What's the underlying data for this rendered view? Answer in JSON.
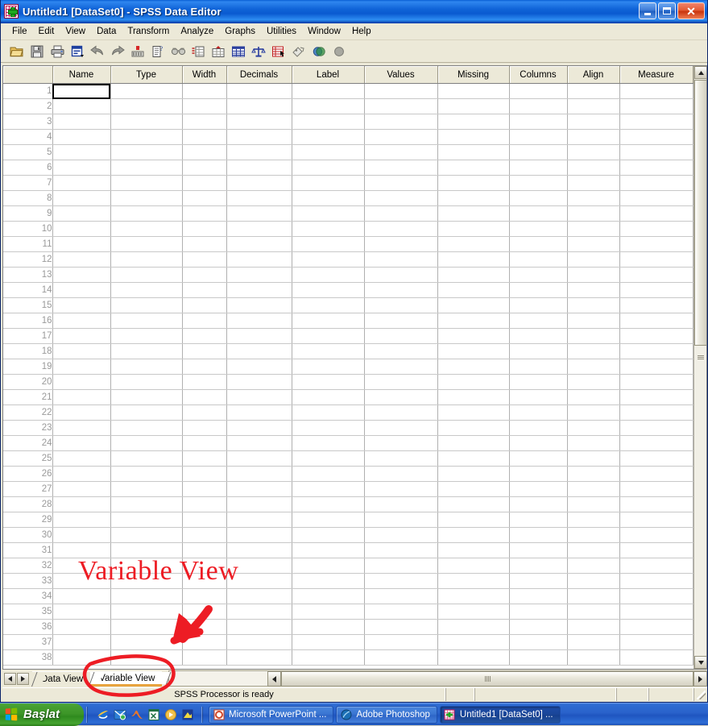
{
  "window": {
    "title": "Untitled1 [DataSet0] - SPSS Data Editor",
    "icon": "spss-icon",
    "minimize_label": "Minimize",
    "restore_label": "Restore",
    "close_label": "Close"
  },
  "menubar": {
    "items": [
      {
        "label": "File"
      },
      {
        "label": "Edit"
      },
      {
        "label": "View"
      },
      {
        "label": "Data"
      },
      {
        "label": "Transform"
      },
      {
        "label": "Analyze"
      },
      {
        "label": "Graphs"
      },
      {
        "label": "Utilities"
      },
      {
        "label": "Window"
      },
      {
        "label": "Help"
      }
    ]
  },
  "toolbar": {
    "buttons": [
      {
        "name": "open-file-icon",
        "title": "Open data document"
      },
      {
        "name": "save-icon",
        "title": "Save this document"
      },
      {
        "name": "print-icon",
        "title": "Print"
      },
      {
        "name": "dialog-recall-icon",
        "title": "Recall recently used dialogs"
      },
      {
        "name": "undo-icon",
        "title": "Undo a user action"
      },
      {
        "name": "redo-icon",
        "title": "Redo a user action"
      },
      {
        "name": "goto-case-icon",
        "title": "Go to case"
      },
      {
        "name": "variables-icon",
        "title": "Variables"
      },
      {
        "name": "find-icon",
        "title": "Find"
      },
      {
        "name": "insert-case-icon",
        "title": "Insert cases"
      },
      {
        "name": "insert-variable-icon",
        "title": "Insert variables"
      },
      {
        "name": "split-file-icon",
        "title": "Split file"
      },
      {
        "name": "weight-cases-icon",
        "title": "Weight cases"
      },
      {
        "name": "select-cases-icon",
        "title": "Select cases"
      },
      {
        "name": "value-labels-icon",
        "title": "Value labels"
      },
      {
        "name": "use-sets-icon",
        "title": "Use sets"
      },
      {
        "name": "show-all-variables-icon",
        "title": "Show all variables"
      }
    ]
  },
  "grid": {
    "columns": [
      {
        "label": "Name",
        "key": "c-name"
      },
      {
        "label": "Type",
        "key": "c-type"
      },
      {
        "label": "Width",
        "key": "c-width"
      },
      {
        "label": "Decimals",
        "key": "c-dec"
      },
      {
        "label": "Label",
        "key": "c-label"
      },
      {
        "label": "Values",
        "key": "c-values"
      },
      {
        "label": "Missing",
        "key": "c-missing"
      },
      {
        "label": "Columns",
        "key": "c-columns"
      },
      {
        "label": "Align",
        "key": "c-align"
      },
      {
        "label": "Measure",
        "key": "c-measure"
      }
    ],
    "row_numbers": [
      1,
      2,
      3,
      4,
      5,
      6,
      7,
      8,
      9,
      10,
      11,
      12,
      13,
      14,
      15,
      16,
      17,
      18,
      19,
      20,
      21,
      22,
      23,
      24,
      25,
      26,
      27,
      28,
      29,
      30,
      31,
      32,
      33,
      34,
      35,
      36,
      37,
      38
    ],
    "selected_cell": {
      "row": 1,
      "column": "Name",
      "value": ""
    },
    "cell_values": []
  },
  "tabs": {
    "prev_label": "◀",
    "next_label": "▶",
    "items": [
      {
        "label": "Data View",
        "active": false
      },
      {
        "label": "Variable View",
        "active": true
      }
    ]
  },
  "scrollbars": {
    "v_up_label": "▲",
    "v_down_label": "▼",
    "h_left_label": "❮",
    "h_right_label": "❯"
  },
  "statusbar": {
    "message": "SPSS Processor is ready"
  },
  "annotations": {
    "text": "Variable View",
    "color": "#ed1c24",
    "arrow_name": "red-arrow-annotation",
    "ellipse_name": "red-ellipse-annotation"
  },
  "taskbar": {
    "start_label": "Başlat",
    "quicklaunch": [
      {
        "name": "internet-explorer-icon"
      },
      {
        "name": "outlook-express-icon"
      },
      {
        "name": "matlab-icon"
      },
      {
        "name": "excel-icon"
      },
      {
        "name": "media-player-icon"
      },
      {
        "name": "paint-shop-icon"
      }
    ],
    "tasks": [
      {
        "label": "Microsoft PowerPoint ...",
        "icon": "powerpoint-icon",
        "active": false
      },
      {
        "label": "Adobe Photoshop",
        "icon": "photoshop-icon",
        "active": false
      },
      {
        "label": "Untitled1 [DataSet0] ...",
        "icon": "spss-icon",
        "active": true
      }
    ]
  }
}
